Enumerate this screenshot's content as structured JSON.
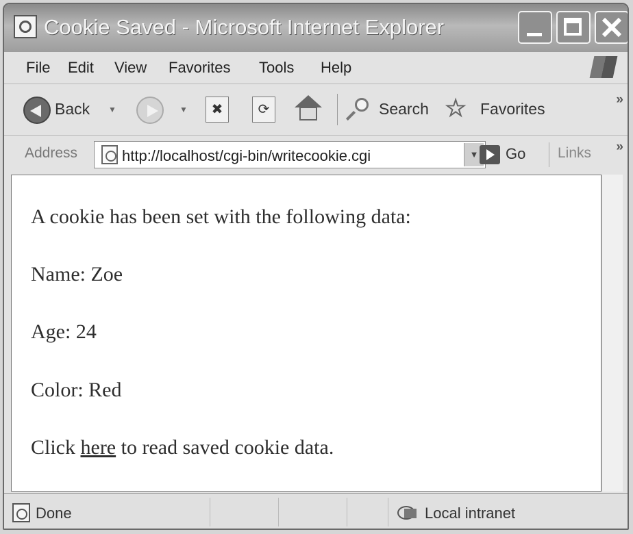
{
  "window": {
    "title": "Cookie Saved - Microsoft Internet Explorer"
  },
  "menu": [
    "File",
    "Edit",
    "View",
    "Favorites",
    "Tools",
    "Help"
  ],
  "toolbar": {
    "back_label": "Back",
    "search_label": "Search",
    "favorites_label": "Favorites",
    "overflow": "»"
  },
  "address": {
    "label": "Address",
    "url": "http://localhost/cgi-bin/writecookie.cgi",
    "go_label": "Go",
    "links_label": "Links",
    "overflow": "»"
  },
  "content": {
    "intro": "A cookie has been set with the following data:",
    "name_line": "Name: Zoe",
    "age_line": "Age: 24",
    "color_line": "Color: Red",
    "click_prefix": "Click ",
    "link_text": "here",
    "click_suffix": " to read saved cookie data."
  },
  "status": {
    "text": "Done",
    "zone": "Local intranet"
  },
  "icons": [
    "ie-page-icon",
    "minimize-icon",
    "maximize-icon",
    "close-icon",
    "windows-logo-icon",
    "back-arrow-icon",
    "forward-arrow-icon",
    "stop-icon",
    "refresh-icon",
    "home-icon",
    "search-icon",
    "favorites-star-icon",
    "go-arrow-icon",
    "local-intranet-icon"
  ]
}
